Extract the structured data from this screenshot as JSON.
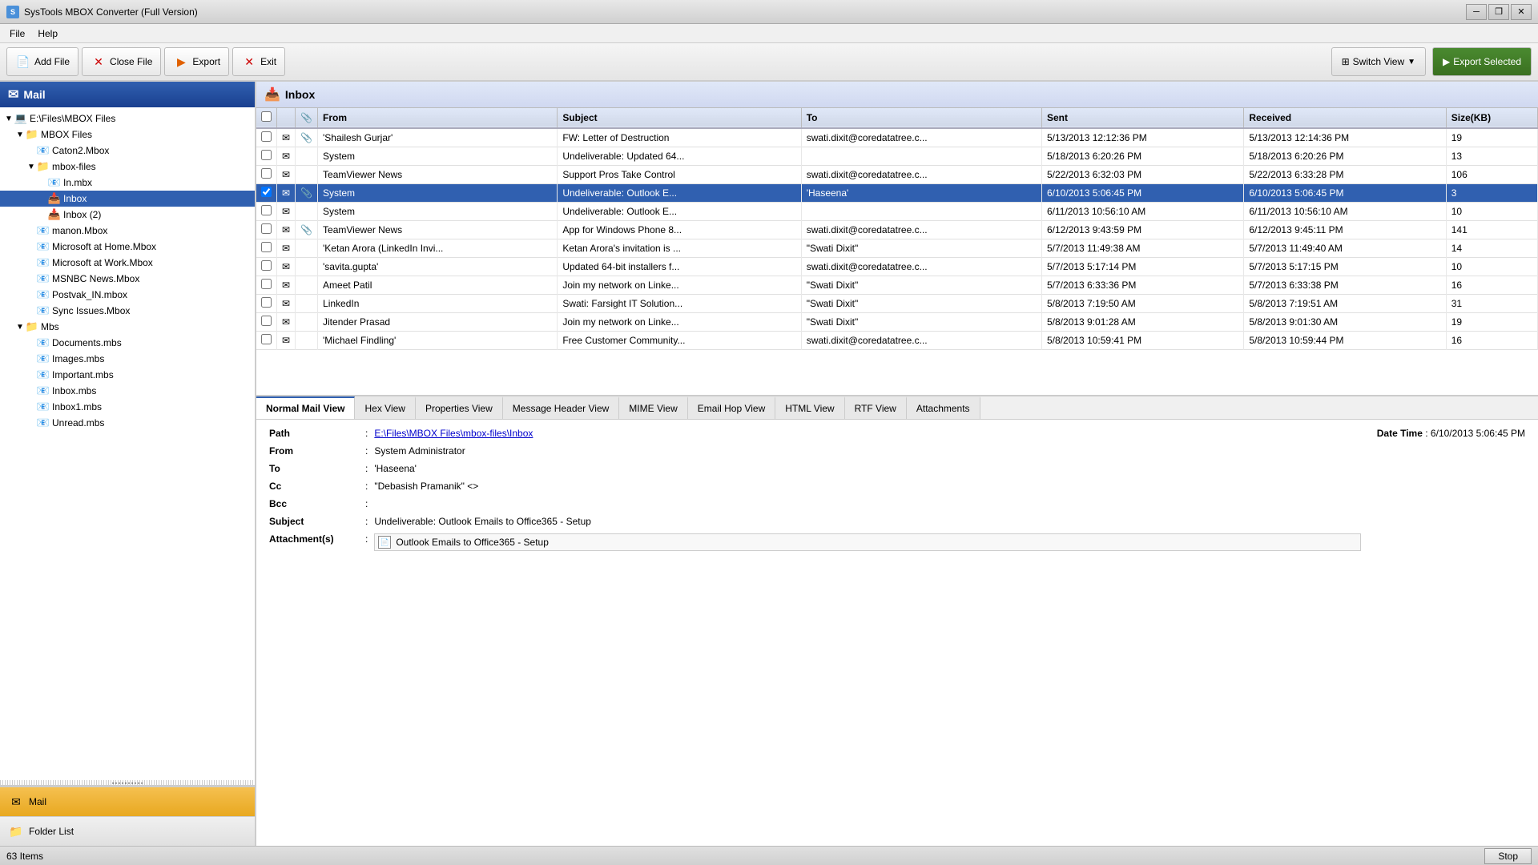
{
  "window": {
    "title": "SysTools MBOX Converter (Full Version)",
    "controls": [
      "minimize",
      "restore",
      "close"
    ]
  },
  "menubar": {
    "items": [
      "File",
      "Help"
    ]
  },
  "toolbar": {
    "add_file_label": "Add File",
    "close_file_label": "Close File",
    "export_label": "Export",
    "exit_label": "Exit",
    "switch_view_label": "Switch View",
    "export_selected_label": "Export Selected"
  },
  "left_panel": {
    "header": "Mail",
    "tree": [
      {
        "id": "root",
        "label": "E:\\Files\\MBOX Files",
        "level": 0,
        "type": "computer",
        "expanded": true
      },
      {
        "id": "mbox-files",
        "label": "MBOX Files",
        "level": 1,
        "type": "folder",
        "expanded": true
      },
      {
        "id": "caton2",
        "label": "Caton2.Mbox",
        "level": 2,
        "type": "mbox"
      },
      {
        "id": "mbox-files-sub",
        "label": "mbox-files",
        "level": 2,
        "type": "folder",
        "expanded": true
      },
      {
        "id": "in-mbx",
        "label": "In.mbx",
        "level": 3,
        "type": "mbox"
      },
      {
        "id": "inbox",
        "label": "Inbox",
        "level": 3,
        "type": "inbox",
        "selected": true
      },
      {
        "id": "inbox2",
        "label": "Inbox (2)",
        "level": 3,
        "type": "inbox"
      },
      {
        "id": "manon",
        "label": "manon.Mbox",
        "level": 2,
        "type": "mbox"
      },
      {
        "id": "microsoft-home",
        "label": "Microsoft at Home.Mbox",
        "level": 2,
        "type": "mbox"
      },
      {
        "id": "microsoft-work",
        "label": "Microsoft at Work.Mbox",
        "level": 2,
        "type": "mbox"
      },
      {
        "id": "msnbc",
        "label": "MSNBC News.Mbox",
        "level": 2,
        "type": "mbox"
      },
      {
        "id": "postvak",
        "label": "Postvak_IN.mbox",
        "level": 2,
        "type": "mbox"
      },
      {
        "id": "sync",
        "label": "Sync Issues.Mbox",
        "level": 2,
        "type": "mbox"
      },
      {
        "id": "mbs",
        "label": "Mbs",
        "level": 1,
        "type": "folder",
        "expanded": true
      },
      {
        "id": "documents",
        "label": "Documents.mbs",
        "level": 2,
        "type": "mbox"
      },
      {
        "id": "images",
        "label": "Images.mbs",
        "level": 2,
        "type": "mbox"
      },
      {
        "id": "important",
        "label": "Important.mbs",
        "level": 2,
        "type": "mbox"
      },
      {
        "id": "inbox-mbs",
        "label": "Inbox.mbs",
        "level": 2,
        "type": "mbox"
      },
      {
        "id": "inbox1",
        "label": "Inbox1.mbs",
        "level": 2,
        "type": "mbox"
      },
      {
        "id": "unread",
        "label": "Unread.mbs",
        "level": 2,
        "type": "mbox"
      }
    ],
    "mail_section_label": "Mail",
    "folder_section_label": "Folder List"
  },
  "email_list": {
    "header": "Inbox",
    "columns": [
      "",
      "",
      "",
      "From",
      "Subject",
      "To",
      "Sent",
      "Received",
      "Size(KB)"
    ],
    "rows": [
      {
        "checkbox": false,
        "icon": "email",
        "attach": true,
        "from": "'Shailesh Gurjar' <shailes...",
        "subject": "FW: Letter of Destruction",
        "to": "swati.dixit@coredatatree.c...",
        "sent": "5/13/2013 12:12:36 PM",
        "received": "5/13/2013 12:14:36 PM",
        "size": "19",
        "selected": false
      },
      {
        "checkbox": false,
        "icon": "email",
        "attach": false,
        "from": "System",
        "subject": "Undeliverable: Updated 64...",
        "to": "",
        "sent": "5/18/2013 6:20:26 PM",
        "received": "5/18/2013 6:20:26 PM",
        "size": "13",
        "selected": false
      },
      {
        "checkbox": false,
        "icon": "email",
        "attach": false,
        "from": "TeamViewer News <mailin...",
        "subject": "Support Pros Take Control",
        "to": "swati.dixit@coredatatree.c...",
        "sent": "5/22/2013 6:32:03 PM",
        "received": "5/22/2013 6:33:28 PM",
        "size": "106",
        "selected": false
      },
      {
        "checkbox": true,
        "icon": "email",
        "attach": true,
        "from": "System",
        "subject": "Undeliverable: Outlook E...",
        "to": "'Haseena'",
        "sent": "6/10/2013 5:06:45 PM",
        "received": "6/10/2013 5:06:45 PM",
        "size": "3",
        "selected": true
      },
      {
        "checkbox": false,
        "icon": "email",
        "attach": false,
        "from": "System",
        "subject": "Undeliverable: Outlook E...",
        "to": "",
        "sent": "6/11/2013 10:56:10 AM",
        "received": "6/11/2013 10:56:10 AM",
        "size": "10",
        "selected": false
      },
      {
        "checkbox": false,
        "icon": "email",
        "attach": true,
        "from": "TeamViewer News <mailin...",
        "subject": "App for Windows Phone 8...",
        "to": "swati.dixit@coredatatree.c...",
        "sent": "6/12/2013 9:43:59 PM",
        "received": "6/12/2013 9:45:11 PM",
        "size": "141",
        "selected": false
      },
      {
        "checkbox": false,
        "icon": "email",
        "attach": false,
        "from": "'Ketan Arora (LinkedIn Invi...",
        "subject": "Ketan Arora's invitation is ...",
        "to": "\"Swati Dixit\" <swati.dixit@...",
        "sent": "5/7/2013 11:49:38 AM",
        "received": "5/7/2013 11:49:40 AM",
        "size": "14",
        "selected": false
      },
      {
        "checkbox": false,
        "icon": "email",
        "attach": false,
        "from": "'savita.gupta' <savita.gup...",
        "subject": "Updated 64-bit installers f...",
        "to": "swati.dixit@coredatatree.c...",
        "sent": "5/7/2013 5:17:14 PM",
        "received": "5/7/2013 5:17:15 PM",
        "size": "10",
        "selected": false
      },
      {
        "checkbox": false,
        "icon": "email",
        "attach": false,
        "from": "Ameet Patil <member@lin...",
        "subject": "Join my network on Linke...",
        "to": "\"Swati Dixit\" <swati.dixit@...",
        "sent": "5/7/2013 6:33:36 PM",
        "received": "5/7/2013 6:33:38 PM",
        "size": "16",
        "selected": false
      },
      {
        "checkbox": false,
        "icon": "email",
        "attach": false,
        "from": "LinkedIn <jobs-listings@li...",
        "subject": "Swati: Farsight IT Solution...",
        "to": "\"Swati Dixit\" <swati.dixit@...",
        "sent": "5/8/2013 7:19:50 AM",
        "received": "5/8/2013 7:19:51 AM",
        "size": "31",
        "selected": false
      },
      {
        "checkbox": false,
        "icon": "email",
        "attach": false,
        "from": "Jitender Prasad <member...",
        "subject": "Join my network on Linke...",
        "to": "\"Swati Dixit\" <swati.dixit@...",
        "sent": "5/8/2013 9:01:28 AM",
        "received": "5/8/2013 9:01:30 AM",
        "size": "19",
        "selected": false
      },
      {
        "checkbox": false,
        "icon": "email",
        "attach": false,
        "from": "'Michael Findling' <micha...",
        "subject": "Free Customer Community...",
        "to": "swati.dixit@coredatatree.c...",
        "sent": "5/8/2013 10:59:41 PM",
        "received": "5/8/2013 10:59:44 PM",
        "size": "16",
        "selected": false
      }
    ]
  },
  "tabs": [
    "Normal Mail View",
    "Hex View",
    "Properties View",
    "Message Header View",
    "MIME View",
    "Email Hop View",
    "HTML View",
    "RTF View",
    "Attachments"
  ],
  "active_tab": "Normal Mail View",
  "detail": {
    "path_label": "Path",
    "from_label": "From",
    "to_label": "To",
    "cc_label": "Cc",
    "bcc_label": "Bcc",
    "subject_label": "Subject",
    "attachments_label": "Attachment(s)",
    "path_value": "E:\\Files\\MBOX Files\\mbox-files\\Inbox",
    "from_value": "System Administrator",
    "to_value": "'Haseena'",
    "cc_value": "\"Debasish Pramanik\" <>",
    "bcc_value": "",
    "subject_value": "Undeliverable: Outlook Emails to Office365 - Setup",
    "attachment_name": "Outlook Emails to Office365 - Setup",
    "date_time_label": "Date Time",
    "date_time_value": "6/10/2013 5:06:45 PM"
  },
  "statusbar": {
    "items_label": "63 Items",
    "stop_label": "Stop"
  }
}
